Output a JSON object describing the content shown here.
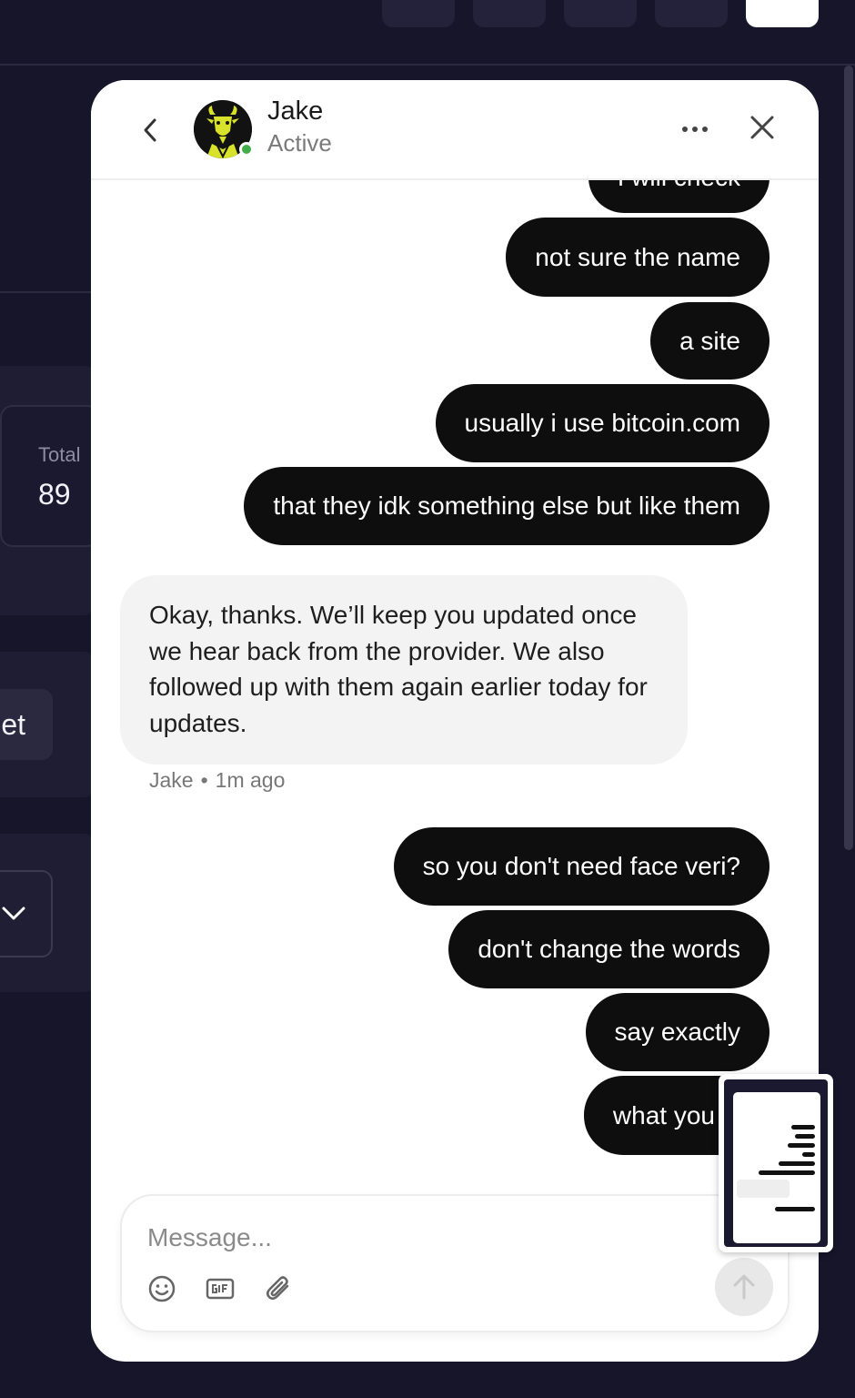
{
  "background": {
    "stat_label": "Total",
    "stat_value": "89",
    "button_fragment": "et"
  },
  "chat": {
    "contact_name": "Jake",
    "contact_status": "Active",
    "messages_out_top": [
      "I will check",
      "not sure the name",
      "a site",
      "usually i use bitcoin.com",
      "that they idk something else but like them"
    ],
    "message_in": {
      "text": "Okay, thanks. We’ll keep you updated once we hear back from the provider. We also followed up with them again earlier today for updates.",
      "author": "Jake",
      "separator": "•",
      "time": "1m ago"
    },
    "messages_out_bottom": [
      "so you don't need face veri?",
      "don't change the words",
      "say exactly",
      "what you w"
    ],
    "composer": {
      "placeholder": "Message..."
    }
  },
  "colors": {
    "app_background": "#16152a",
    "outgoing_bubble": "#0e0e0e",
    "incoming_bubble": "#f3f3f3",
    "presence_online": "#3fae4a",
    "accent_orange": "#f07a1a"
  },
  "icons": [
    "back-chevron-icon",
    "more-icon",
    "close-icon",
    "emoji-icon",
    "gif-icon",
    "attach-icon",
    "send-arrow-icon",
    "search-icon"
  ]
}
